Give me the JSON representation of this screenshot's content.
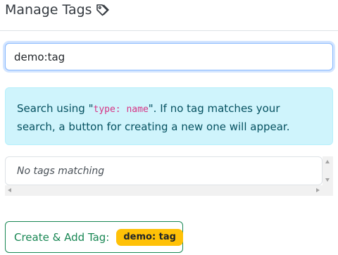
{
  "header": {
    "title": "Manage Tags",
    "icon": "tag-icon"
  },
  "search": {
    "value": "demo:tag",
    "placeholder": ""
  },
  "info": {
    "prefix": "Search using \"",
    "code": "type: name",
    "suffix": "\". If no tag matches your search, a button for creating a new one will appear."
  },
  "results": {
    "empty_text": "No tags matching"
  },
  "create": {
    "label": "Create & Add Tag:",
    "badge": "demo: tag"
  },
  "colors": {
    "info_bg": "#cff4fc",
    "info_text": "#055160",
    "code": "#d63384",
    "success": "#198754",
    "badge": "#ffc107"
  }
}
